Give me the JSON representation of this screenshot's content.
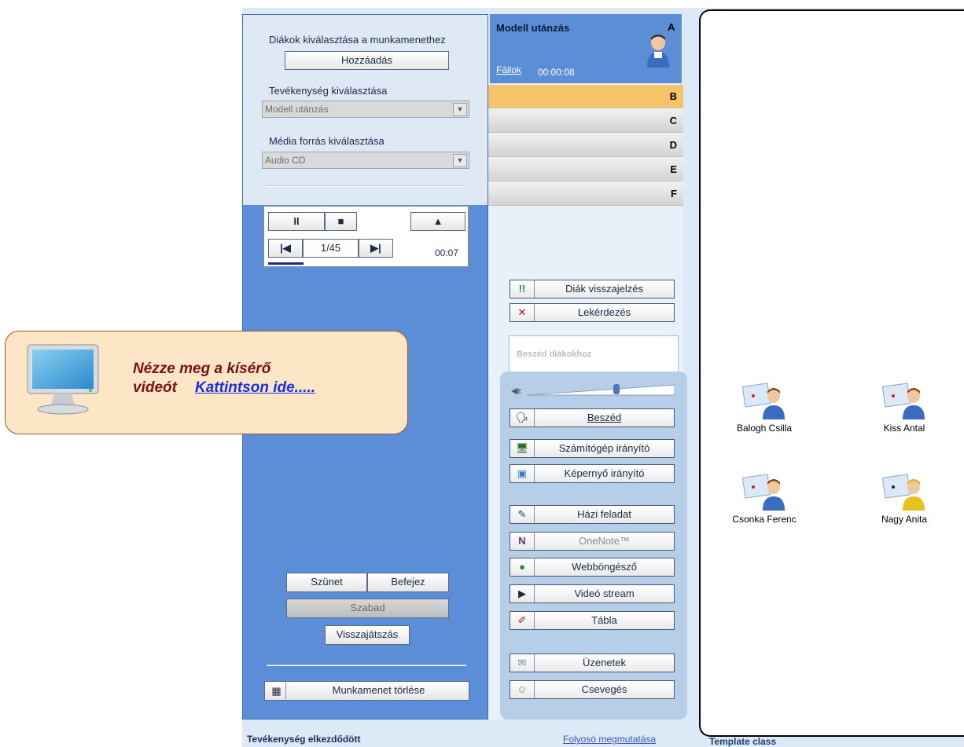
{
  "left": {
    "students_label": "Diákok kiválasztása a munkamenethez",
    "add_button": "Hozzáadás",
    "activity_label": "Tevékenység kiválasztása",
    "activity_value": "Modell utánzás",
    "media_label": "Média forrás kiválasztása",
    "media_value": "Audio CD"
  },
  "player": {
    "pause": "II",
    "stop": "■",
    "eject": "▲",
    "prev": "|◀",
    "track": "1/45",
    "next": "▶|",
    "time": "00:07"
  },
  "session_controls": {
    "pause": "Szünet",
    "finish": "Befejez",
    "free": "Szabad",
    "playback": "Visszajátszás",
    "delete": "Munkamenet törlése"
  },
  "tab_a": {
    "title": "Modell utánzás",
    "letter": "A",
    "files_link": "Fáilok",
    "timer": "00:00:08"
  },
  "tabs": [
    "B",
    "C",
    "D",
    "E",
    "F"
  ],
  "feedback": {
    "student_feedback": "Diák visszajelzés",
    "quiz": "Lekérdezés",
    "speak_tab": "Beszéd diákokhoz"
  },
  "tools": [
    {
      "label": "Beszéd",
      "icon": "microphone-icon",
      "glyph": "🗣"
    },
    {
      "label": "Számítógép irányító",
      "icon": "pc-control-icon",
      "glyph": "🖥"
    },
    {
      "label": "Képernyő irányító",
      "icon": "screen-control-icon",
      "glyph": "▣"
    },
    {
      "label": "Házi feladat",
      "icon": "homework-icon",
      "glyph": "✎"
    },
    {
      "label": "OneNote™",
      "icon": "onenote-icon",
      "glyph": "N"
    },
    {
      "label": "Webböngésző",
      "icon": "globe-icon",
      "glyph": "●"
    },
    {
      "label": "Videó stream",
      "icon": "video-icon",
      "glyph": "▶"
    },
    {
      "label": "Tábla",
      "icon": "whiteboard-icon",
      "glyph": "✐"
    },
    {
      "label": "Üzenetek",
      "icon": "envelope-icon",
      "glyph": "✉"
    },
    {
      "label": "Csevegés",
      "icon": "chat-icon",
      "glyph": "☺"
    }
  ],
  "popup": {
    "line1": "Nézze meg a kísérő",
    "line2_prefix": "videót",
    "link": "Kattintson ide....."
  },
  "students": [
    {
      "name": "Balogh Csilla"
    },
    {
      "name": "Kiss Antal"
    },
    {
      "name": "Csonka Ferenc"
    },
    {
      "name": "Nagy Anita"
    }
  ],
  "footer": {
    "status": "Tevékenység elkezdődött",
    "hallway_link": "Folyosó megmutatása",
    "class_name": "Template class"
  },
  "colors": {
    "panel_blue": "#5b8ed6",
    "selected_tab": "#f7c46a",
    "popup_bg": "#fde6c6",
    "popup_text": "#7a1010",
    "link_blue": "#1530e0"
  }
}
